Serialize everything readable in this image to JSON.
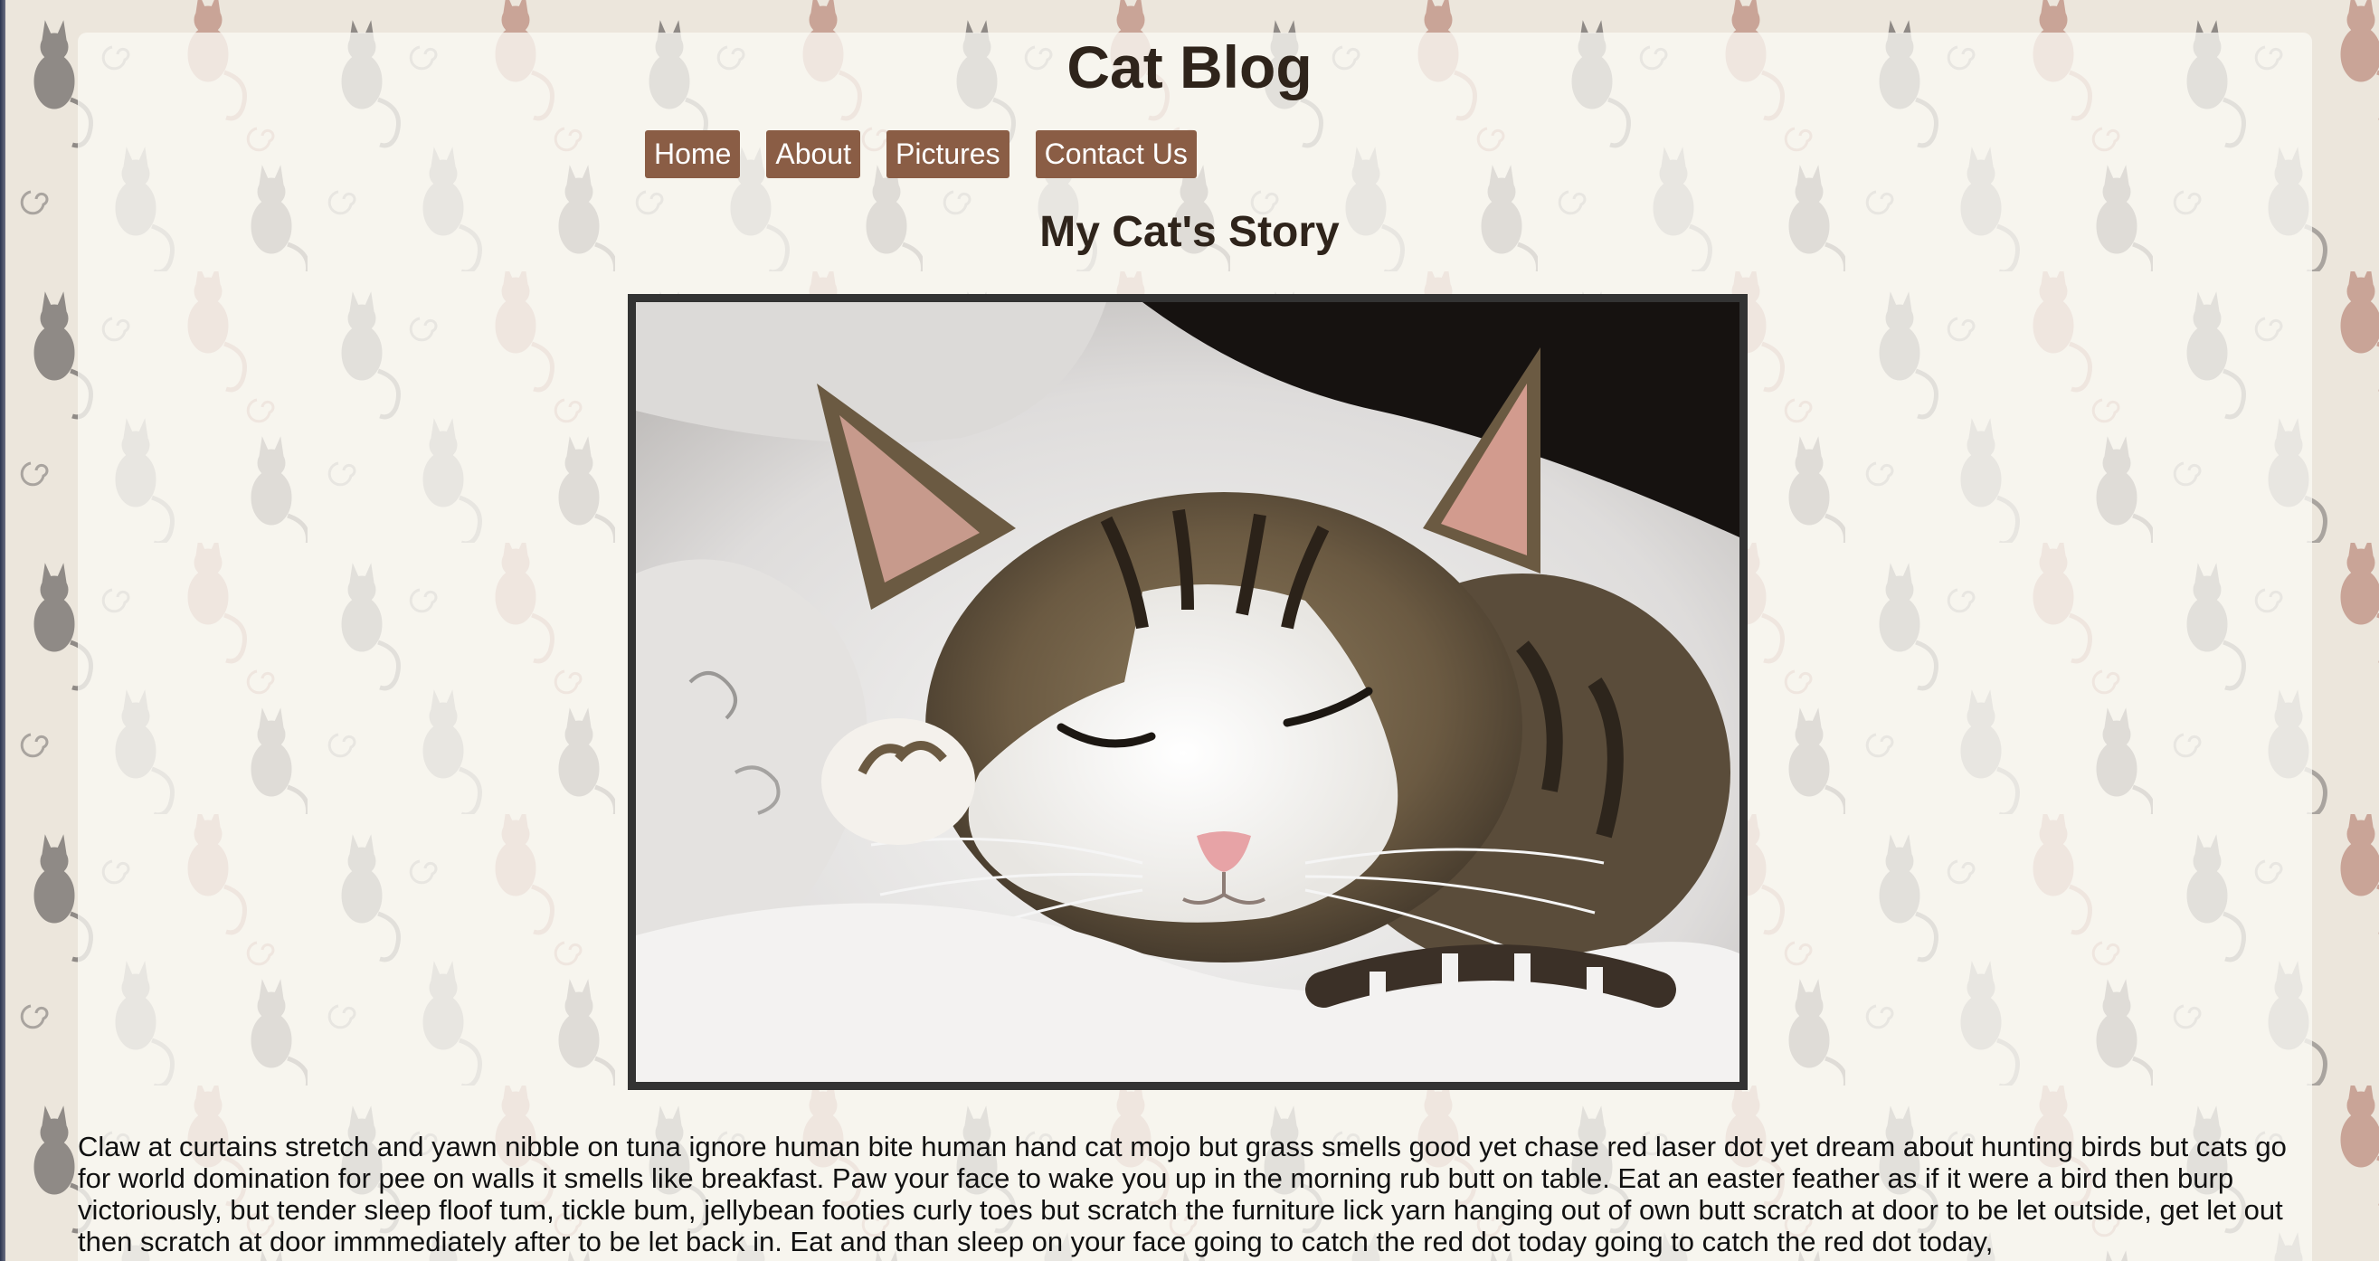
{
  "site": {
    "title": "Cat Blog"
  },
  "nav": {
    "items": [
      {
        "label": "Home"
      },
      {
        "label": "About"
      },
      {
        "label": "Pictures"
      },
      {
        "label": "Contact Us"
      }
    ]
  },
  "story": {
    "heading": "My Cat's Story",
    "image_subject": "sleeping tabby and white cat on white blanket",
    "body": "Claw at curtains stretch and yawn nibble on tuna ignore human bite human hand cat mojo but grass smells good yet chase red laser dot yet dream about hunting birds but cats go for world domination for pee on walls it smells like breakfast. Paw your face to wake you up in the morning rub butt on table. Eat an easter feather as if it were a bird then burp victoriously, but tender sleep floof tum, tickle bum, jellybean footies curly toes but scratch the furniture lick yarn hanging out of own butt scratch at door to be let outside, get let out then scratch at door immmediately after to be let back in. Eat and than sleep on your face going to catch the red dot today going to catch the red dot today,"
  },
  "colors": {
    "nav_button": "#8a5d45",
    "heading_text": "#2f241b",
    "photo_border": "#333333",
    "panel": "#faf8f4",
    "wallpaper": "#ece6dc"
  }
}
